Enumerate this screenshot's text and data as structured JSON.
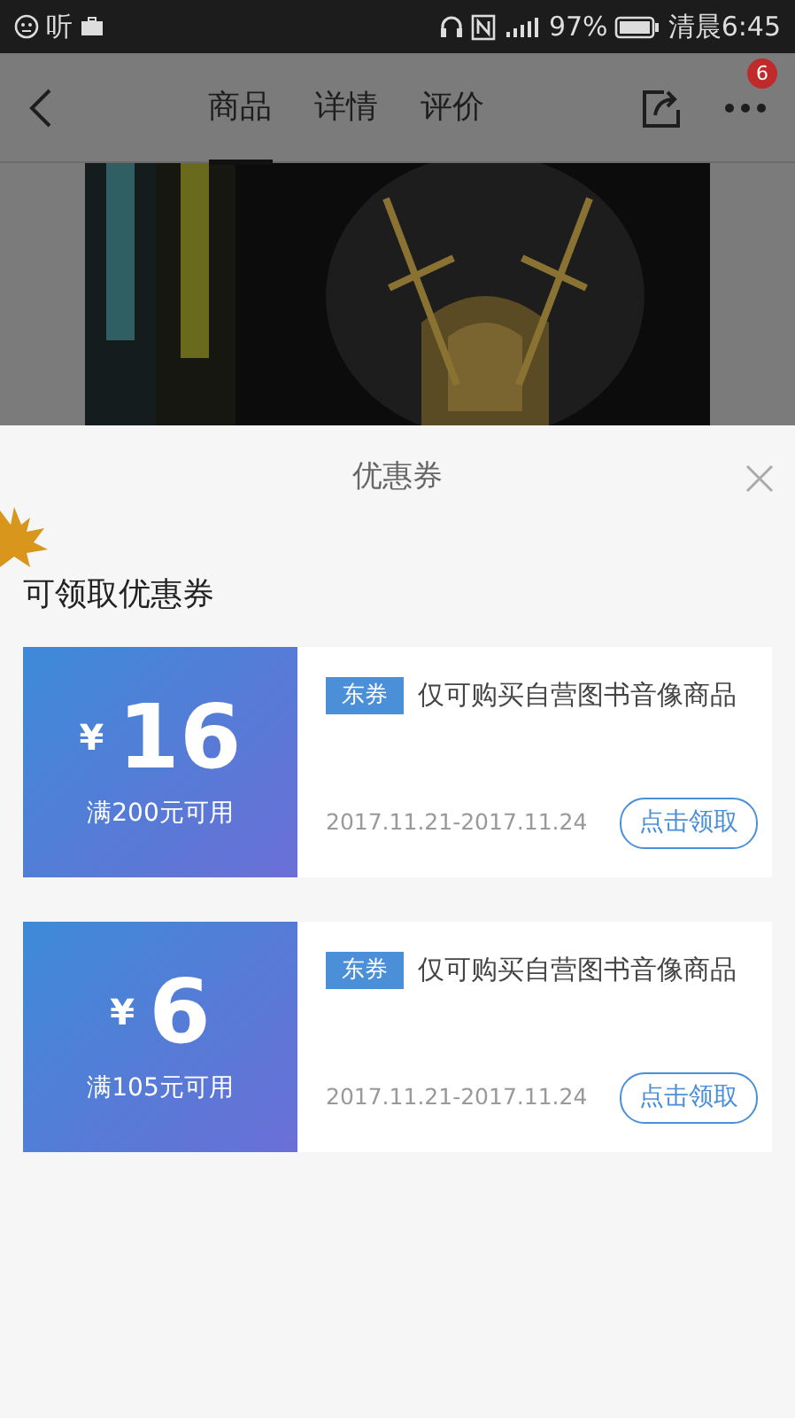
{
  "status_bar": {
    "left_text": "听",
    "battery": "97%",
    "time": "清晨6:45"
  },
  "nav": {
    "tabs": [
      {
        "label": "商品",
        "selected": true
      },
      {
        "label": "详情",
        "selected": false
      },
      {
        "label": "评价",
        "selected": false
      }
    ],
    "more_badge": "6"
  },
  "sheet": {
    "title": "优惠券",
    "section_title": "可领取优惠券",
    "coupons": [
      {
        "currency": "¥",
        "amount": "16",
        "condition": "满200元可用",
        "tag": "东券",
        "description": "仅可购买自营图书音像商品",
        "validity": "2017.11.21-2017.11.24",
        "button": "点击领取"
      },
      {
        "currency": "¥",
        "amount": "6",
        "condition": "满105元可用",
        "tag": "东券",
        "description": "仅可购买自营图书音像商品",
        "validity": "2017.11.21-2017.11.24",
        "button": "点击领取"
      }
    ]
  }
}
